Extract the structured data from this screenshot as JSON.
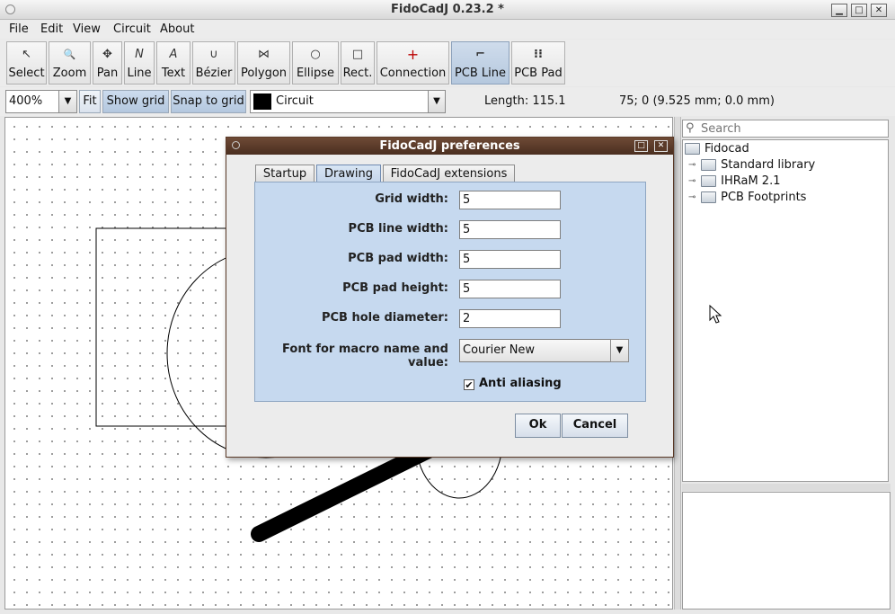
{
  "window": {
    "title": "FidoCadJ 0.23.2  *"
  },
  "menu": [
    "File",
    "Edit",
    "View",
    "Circuit",
    "About"
  ],
  "toolbar": {
    "tools": [
      {
        "label": "Select",
        "icon": "select-arrow-icon",
        "glyph": "↖"
      },
      {
        "label": "Zoom",
        "icon": "magnifier-icon",
        "glyph": "🔍"
      },
      {
        "label": "Pan",
        "icon": "move-cross-icon",
        "glyph": "✥"
      },
      {
        "label": "Line",
        "icon": "line-tool-icon",
        "glyph": "N"
      },
      {
        "label": "Text",
        "icon": "text-tool-icon",
        "glyph": "A"
      },
      {
        "label": "Bézier",
        "icon": "bezier-curve-icon",
        "glyph": "∪"
      },
      {
        "label": "Polygon",
        "icon": "polygon-icon",
        "glyph": "⋈"
      },
      {
        "label": "Ellipse",
        "icon": "ellipse-icon",
        "glyph": "○"
      },
      {
        "label": "Rect.",
        "icon": "rectangle-icon",
        "glyph": "□"
      },
      {
        "label": "Connection",
        "icon": "connection-plus-icon",
        "glyph": "+"
      },
      {
        "label": "PCB Line",
        "icon": "pcb-line-icon",
        "glyph": "⌐"
      },
      {
        "label": "PCB Pad",
        "icon": "pcb-pad-icon",
        "glyph": "⁝⁝"
      }
    ],
    "selected": "PCB Line"
  },
  "options": {
    "zoom": "400%",
    "fit": "Fit",
    "show_grid": "Show grid",
    "snap_to_grid": "Snap to grid",
    "layer": "Circuit",
    "layer_color": "#000000",
    "length": "Length: 115.1",
    "coords": "75; 0 (9.525 mm; 0.0 mm)"
  },
  "library": {
    "search_placeholder": "Search",
    "root": "Fidocad",
    "children": [
      "Standard library",
      "IHRaM 2.1",
      "PCB Footprints"
    ]
  },
  "dialog": {
    "title": "FidoCadJ preferences",
    "tabs": [
      "Startup",
      "Drawing",
      "FidoCadJ extensions"
    ],
    "active_tab": "Drawing",
    "fields": [
      {
        "label": "Grid width:",
        "value": "5"
      },
      {
        "label": "PCB line width:",
        "value": "5"
      },
      {
        "label": "PCB pad width:",
        "value": "5"
      },
      {
        "label": "PCB pad height:",
        "value": "5"
      },
      {
        "label": "PCB hole diameter:",
        "value": "2"
      }
    ],
    "font_label": "Font for macro name and value:",
    "font_value": "Courier New",
    "anti_aliasing_label": "Anti aliasing",
    "anti_aliasing_checked": true,
    "ok": "Ok",
    "cancel": "Cancel"
  }
}
